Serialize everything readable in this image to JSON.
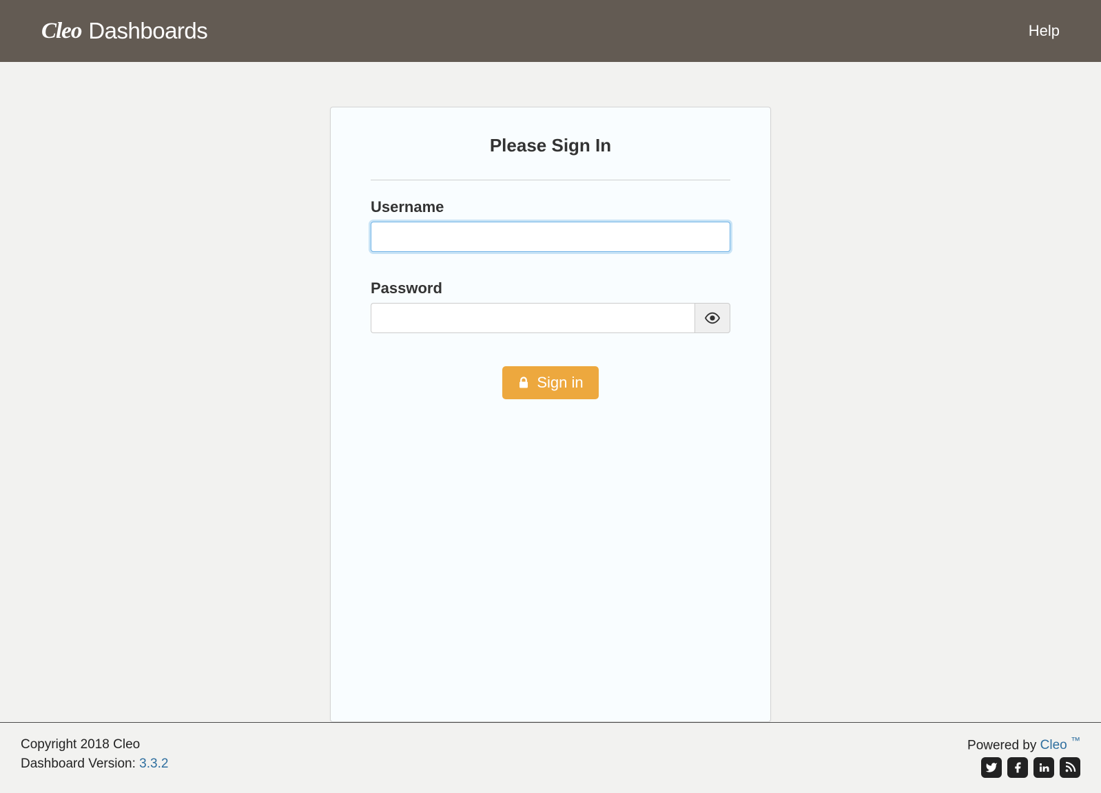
{
  "header": {
    "brand_cleo": "Cleo",
    "brand_dashboards": "Dashboards",
    "help_label": "Help"
  },
  "login": {
    "title": "Please Sign In",
    "username_label": "Username",
    "username_value": "",
    "password_label": "Password",
    "password_value": "",
    "signin_label": "Sign in"
  },
  "footer": {
    "copyright": "Copyright 2018 Cleo",
    "version_label": "Dashboard Version: ",
    "version_value": "3.3.2",
    "powered_prefix": "Powered by ",
    "powered_brand": "Cleo ",
    "powered_tm": "™"
  }
}
